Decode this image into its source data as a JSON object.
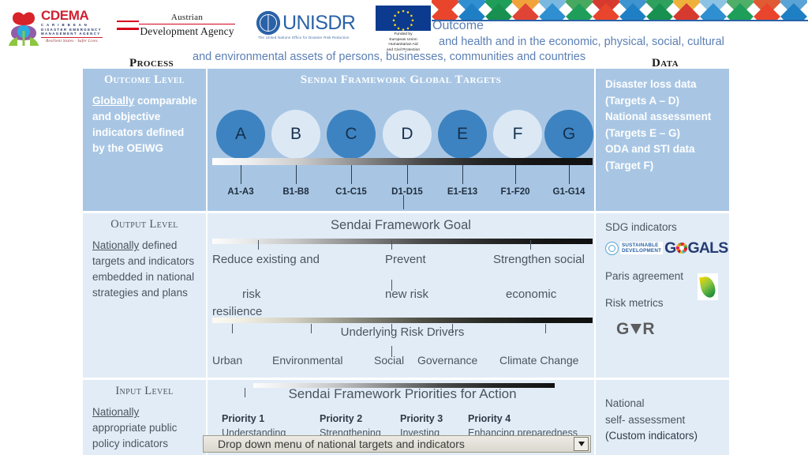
{
  "logos": {
    "cdema": {
      "name": "CDEMA",
      "sub": "C A R I B B E A N\nDISASTER EMERGENCY\nMANAGEMENT AGENCY",
      "tagline": "Resilient States · Safer Lives"
    },
    "ada": {
      "line1": "Austrian",
      "line2": "Development Agency"
    },
    "unisdr": {
      "name": "UNISDR",
      "sub": "The United Nations Office for Disaster Risk Reduction"
    },
    "eu": {
      "caption": "Funded by\nEuropean Union\nHumanitarian Aid\nand Civil Protection"
    }
  },
  "ghost": {
    "outcome": "Outcome",
    "line2": "and health and in the economic, physical, social,  cultural",
    "line3": "and environmental assets of persons, businesses, communities and countries"
  },
  "headers": {
    "process": "Process",
    "data": "Data"
  },
  "outcome": {
    "level_title": "Outcome Level",
    "body_underline": "Globally",
    "body_rest": "comparable and objective indicators defined by the OEIWG",
    "mid_title": "Sendai Framework Global Targets",
    "targets": [
      {
        "letter": "A",
        "range": "A1-A3",
        "style": "dark"
      },
      {
        "letter": "B",
        "range": "B1-B8",
        "style": "light"
      },
      {
        "letter": "C",
        "range": "C1-C15",
        "style": "dark"
      },
      {
        "letter": "D",
        "range": "D1-D15",
        "style": "light"
      },
      {
        "letter": "E",
        "range": "E1-E13",
        "style": "dark"
      },
      {
        "letter": "F",
        "range": "F1-F20",
        "style": "light"
      },
      {
        "letter": "G",
        "range": "G1-G14",
        "style": "dark"
      }
    ],
    "data": [
      "Disaster loss data",
      "(Targets A – D)",
      "National assessment",
      "(Targets E – G)",
      "ODA and STI data",
      "(Target F)"
    ]
  },
  "output": {
    "level_title": "Output Level",
    "body_underline": "Nationally",
    "body_rest": "defined targets and indicators embedded in national strategies and plans",
    "goal_title": "Sendai Framework Goal",
    "goal_items": [
      "Reduce existing and",
      "risk resilience",
      "Prevent",
      "new risk",
      "Strengthen social",
      "economic"
    ],
    "drivers_title": "Underlying Risk Drivers",
    "drivers": [
      "Urban",
      "Environmental",
      "Social",
      "Governance",
      "Climate Change"
    ],
    "data": {
      "sdg_label": "SDG indicators",
      "sdg_logo_line1": "SUSTAINABLE",
      "sdg_logo_line2": "DEVELOPMENT",
      "sdg_logo_goals": "GALS",
      "paris_label": "Paris agreement",
      "risk_label": "Risk metrics",
      "gar_label": "GR"
    }
  },
  "input": {
    "level_title": "Input Level",
    "body_underline": "Nationally",
    "body_rest": "appropriate public policy indicators",
    "priorities_title": "Sendai Framework Priorities for Action",
    "priorities": [
      {
        "name": "Priority 1",
        "desc": "Understanding"
      },
      {
        "name": "Priority 2",
        "desc": "Strengthening"
      },
      {
        "name": "Priority 3",
        "desc": "Investing"
      },
      {
        "name": "Priority 4",
        "desc": "Enhancing preparedness"
      }
    ],
    "data": [
      "National",
      "self- assessment",
      "(Custom indicators)"
    ]
  },
  "dropdown": {
    "label": "Drop down menu of national targets and indicators"
  },
  "colors": {
    "outcome_band": "#a8c6e4",
    "output_band": "#e2ecf6",
    "circle_dark": "#3d83c1",
    "circle_light": "#dce9f5",
    "text_muted": "#4a5560",
    "cdema_red": "#cf2030",
    "un_blue": "#2a62a8"
  }
}
